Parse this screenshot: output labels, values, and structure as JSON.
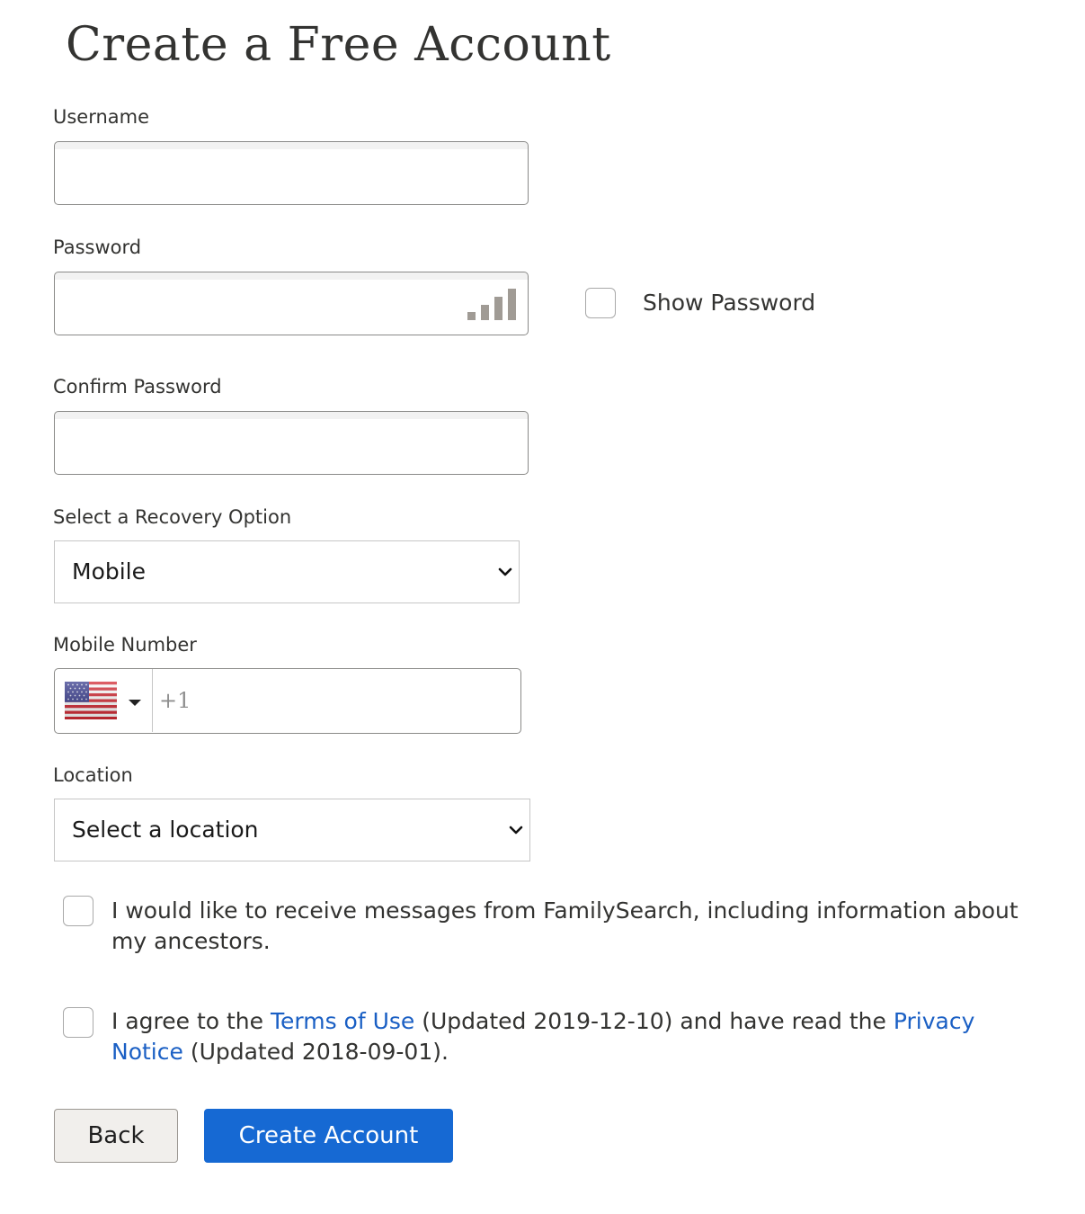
{
  "title": "Create a Free Account",
  "username": {
    "label": "Username",
    "value": ""
  },
  "password": {
    "label": "Password",
    "value": "",
    "strength_icon": "signal-bars-icon"
  },
  "show_password": {
    "label": "Show Password",
    "checked": false
  },
  "confirm_password": {
    "label": "Confirm Password",
    "value": ""
  },
  "recovery": {
    "label": "Select a Recovery Option",
    "selected": "Mobile"
  },
  "mobile": {
    "label": "Mobile Number",
    "country_flag": "us-flag-icon",
    "placeholder": "+1",
    "value": ""
  },
  "location": {
    "label": "Location",
    "selected": "Select a location"
  },
  "consent_messages": {
    "checked": false,
    "text": "I would like to receive messages from FamilySearch, including information about my ancestors."
  },
  "consent_terms": {
    "checked": false,
    "text_before": "I agree to the ",
    "terms_link": "Terms of Use",
    "text_middle": " (Updated 2019-12-10) and have read the ",
    "privacy_link": "Privacy Notice",
    "text_after": " (Updated 2018-09-01)."
  },
  "buttons": {
    "back": "Back",
    "create": "Create Account"
  },
  "colors": {
    "primary": "#1669d3",
    "link": "#1a5fc4",
    "text": "#333331"
  }
}
